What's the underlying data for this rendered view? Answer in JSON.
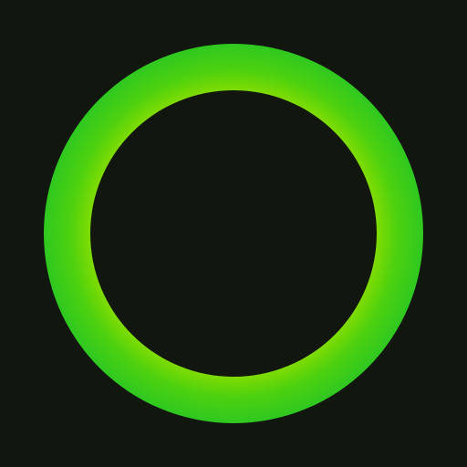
{
  "colors": {
    "background": "#11160e",
    "ring_inner": "#86dd00",
    "ring_mid": "#4ed10f",
    "ring_outer": "#2fc820"
  },
  "icons": {
    "main": "ring-icon"
  }
}
